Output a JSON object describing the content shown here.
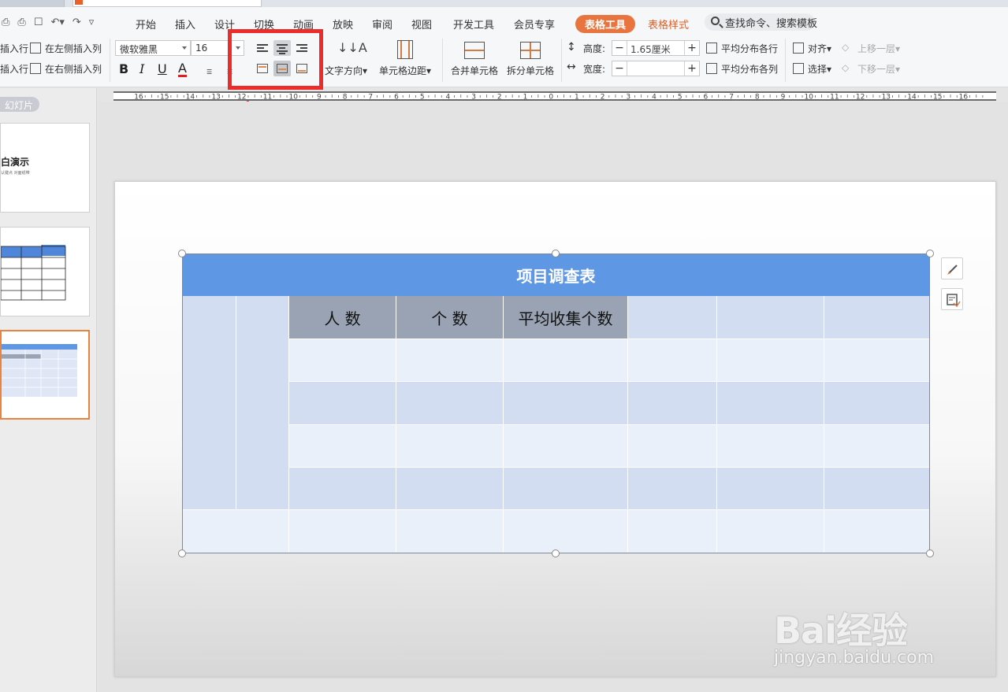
{
  "menu": {
    "tabs": [
      "开始",
      "插入",
      "设计",
      "切换",
      "动画",
      "放映",
      "审阅",
      "视图",
      "开发工具",
      "会员专享"
    ],
    "table_tools": "表格工具",
    "table_style": "表格样式",
    "search_placeholder": "查找命令、搜索模板"
  },
  "ribbon": {
    "insert_row_above": "插入行",
    "insert_row_below": "插入行",
    "insert_col_left": "在左侧插入列",
    "insert_col_right": "在右侧插入列",
    "font_name": "微软雅黑",
    "font_size": "16",
    "bold": "B",
    "italic": "I",
    "underline": "U",
    "font_color": "A",
    "text_direction": "文字方向",
    "cell_margin": "单元格边距",
    "merge_cells": "合并单元格",
    "split_cells": "拆分单元格",
    "height_label": "高度:",
    "height_value": "1.65厘米",
    "width_label": "宽度:",
    "width_value": "",
    "distribute_rows": "平均分布各行",
    "distribute_cols": "平均分布各列",
    "align": "对齐",
    "select": "选择",
    "bring_forward": "上移一层",
    "send_backward": "下移一层"
  },
  "ruler": {
    "labels": [
      "16",
      "15",
      "14",
      "13",
      "12",
      "11",
      "10",
      "9",
      "8",
      "7",
      "6",
      "5",
      "4",
      "3",
      "2",
      "1",
      "0",
      "1",
      "2",
      "3",
      "4",
      "5",
      "6",
      "7",
      "8",
      "9",
      "10",
      "11",
      "12",
      "13",
      "14",
      "15",
      "16"
    ]
  },
  "leftpanel": {
    "tab": "幻灯片",
    "slide1_title": "白演示",
    "slide1_sub": "认键点 对面纸带"
  },
  "table": {
    "title": "项目调查表",
    "headers": [
      "人  数",
      "个  数",
      "平均收集个数"
    ]
  },
  "watermark": {
    "line1": "Bai经验",
    "line2": "jingyan.baidu.com"
  },
  "colors": {
    "accent_orange": "#e8753f",
    "title_blue": "#5e97e3",
    "header_grey": "#9aa3b3",
    "row_light": "#eaf0f9",
    "row_dark": "#d2ddf2",
    "highlight_red": "#ec2b2b"
  }
}
